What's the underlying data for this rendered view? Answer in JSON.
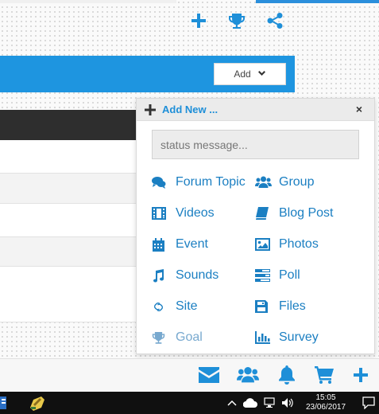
{
  "header": {
    "icons": [
      "plus-icon",
      "trophy-icon",
      "share-icon"
    ]
  },
  "toolbar": {
    "add_label": "Add"
  },
  "popup": {
    "title": "Add New ...",
    "close_label": "×",
    "status_placeholder": "status message...",
    "left_items": [
      {
        "label": "Forum Topic",
        "icon": "comments-icon"
      },
      {
        "label": "Videos",
        "icon": "film-icon"
      },
      {
        "label": "Event",
        "icon": "calendar-icon"
      },
      {
        "label": "Sounds",
        "icon": "music-icon"
      },
      {
        "label": "Site",
        "icon": "link-icon"
      },
      {
        "label": "Goal",
        "icon": "trophy-icon"
      }
    ],
    "right_items": [
      {
        "label": "Group",
        "icon": "users-icon"
      },
      {
        "label": "Blog Post",
        "icon": "book-icon"
      },
      {
        "label": "Photos",
        "icon": "image-icon"
      },
      {
        "label": "Poll",
        "icon": "poll-icon"
      },
      {
        "label": "Files",
        "icon": "save-icon"
      },
      {
        "label": "Survey",
        "icon": "bar-chart-icon"
      }
    ]
  },
  "bottom_bar": {
    "icons": [
      "envelope-icon",
      "users-icon",
      "bell-icon",
      "cart-icon",
      "plus-icon"
    ]
  },
  "taskbar": {
    "time": "15:05",
    "date": "23/06/2017"
  },
  "colors": {
    "accent": "#1e95e0",
    "link": "#1b7fc2",
    "muted_link": "#78a9cf"
  }
}
